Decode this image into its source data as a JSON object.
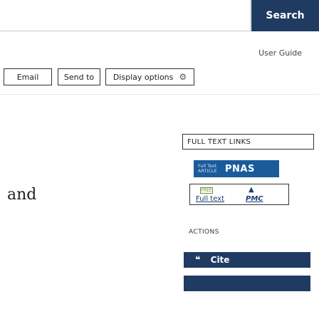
{
  "search": {
    "button_label": "Search",
    "value": ""
  },
  "links": {
    "user_guide": "User Guide"
  },
  "toolbar": {
    "email_label": "Email",
    "send_to_label": "Send to",
    "display_options_label": "Display options",
    "display_options_icon": "gear-icon"
  },
  "main": {
    "side_text": "and"
  },
  "full_text_links": {
    "heading": "FULL TEXT LINKS",
    "pnas": {
      "prefix": "Full Text ARTICLE",
      "brand": "PNAS"
    },
    "pmc": {
      "badge": "FREE",
      "fulltext": "Full text",
      "brand": "PMC"
    }
  },
  "actions": {
    "heading": "ACTIONS",
    "cite_label": "Cite",
    "cite_icon": "quote-icon"
  },
  "colors": {
    "primary_button": "#1f3b62",
    "pnas_blue": "#1a5b9c",
    "pmc_blue": "#1a3e73",
    "free_green": "#6a8f2a"
  }
}
